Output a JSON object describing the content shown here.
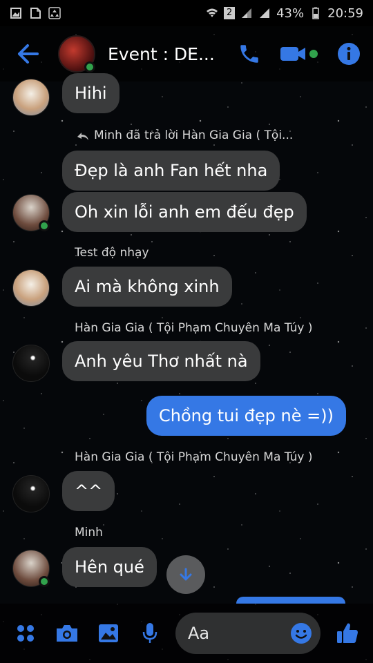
{
  "status_bar": {
    "network_badge": "2",
    "battery": "43%",
    "time": "20:59"
  },
  "header": {
    "title": "Event : DE...",
    "accent_color": "#3578e5",
    "online_color": "#31a24c"
  },
  "messages": [
    {
      "type": "bubble",
      "sender_avatar": "Test độ nhạy",
      "text": "Hihi",
      "mine": false
    },
    {
      "type": "reply_note",
      "text": "Minh đã trả lời Hàn Gia Gia ( Tội..."
    },
    {
      "type": "bubble",
      "sender_avatar": "Minh",
      "text": "Đẹp là anh Fan hết nha",
      "mine": false
    },
    {
      "type": "bubble",
      "sender_avatar": "Minh",
      "text": "Oh xin lỗi anh em đếu đẹp",
      "mine": false
    },
    {
      "type": "sender",
      "text": "Test độ nhạy"
    },
    {
      "type": "bubble",
      "sender_avatar": "Test độ nhạy",
      "text": "Ai mà không xinh",
      "mine": false
    },
    {
      "type": "sender",
      "text": "Hàn Gia Gia ( Tội Phạm Chuyên Ma Túy )"
    },
    {
      "type": "bubble",
      "sender_avatar": "Hàn Gia Gia",
      "text": "Anh yêu Thơ nhất nà",
      "mine": false
    },
    {
      "type": "bubble",
      "text": "Chồng tui đẹp nè =))",
      "mine": true
    },
    {
      "type": "sender",
      "text": "Hàn Gia Gia ( Tội Phạm Chuyên Ma Túy )"
    },
    {
      "type": "bubble",
      "sender_avatar": "Hàn Gia Gia",
      "text": "^^",
      "mine": false
    },
    {
      "type": "sender",
      "text": "Minh"
    },
    {
      "type": "bubble",
      "sender_avatar": "Minh",
      "text": "Hên qué",
      "mine": false
    }
  ],
  "composer": {
    "placeholder": "Aa",
    "buttons": [
      "apps-icon",
      "camera-icon",
      "gallery-icon",
      "microphone-icon",
      "emoji-icon",
      "like-icon"
    ]
  }
}
